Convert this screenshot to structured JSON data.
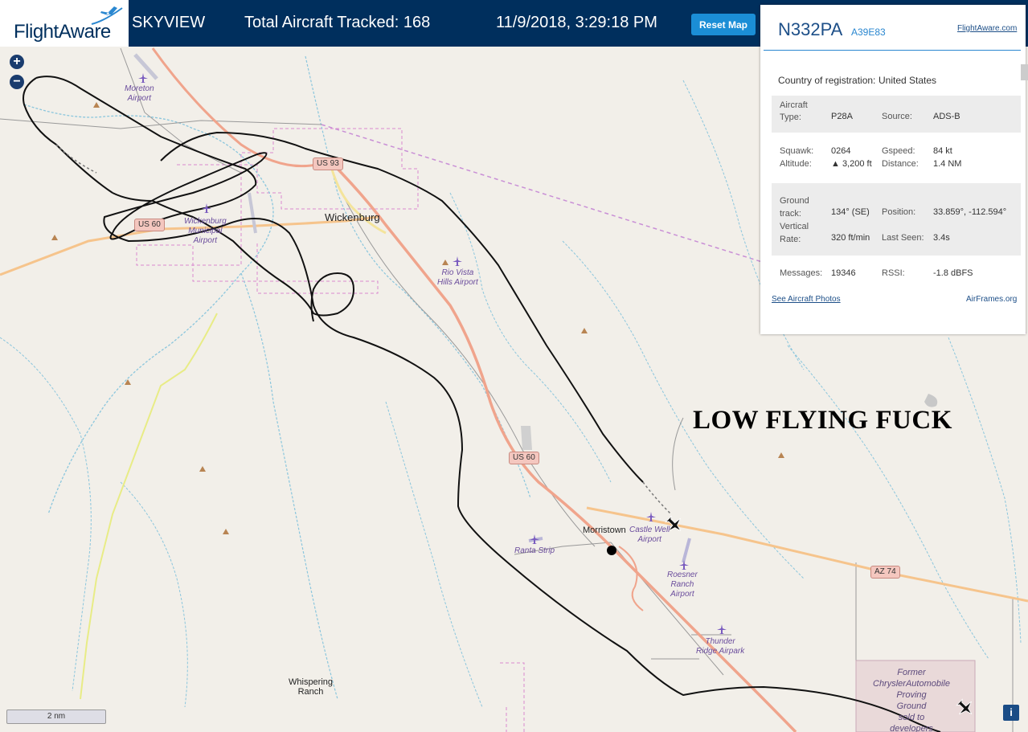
{
  "header": {
    "logo": "FlightAware",
    "app_name": "SKYVIEW",
    "tracked_label": "Total Aircraft Tracked: 168",
    "datetime": "11/9/2018, 3:29:18 PM",
    "reset_label": "Reset Map",
    "bg_color": "#002f5d"
  },
  "map": {
    "zoom_in": "+",
    "zoom_out": "−",
    "scale_label": "2 nm",
    "info_label": "i",
    "annotation": "LOW FLYING FUCK",
    "towns": {
      "wickenburg": "Wickenburg",
      "morristown": "Morristown",
      "whispering": "Whispering\nRanch"
    },
    "airports": {
      "moreton": "Moreton\nAirport",
      "wickenburg_muni": "Wickenburg\nMunicipal\nAirport",
      "rio_vista": "Rio Vista\nHills Airport",
      "castle_well": "Castle Well\nAirport",
      "ranta": "Ranta Strip",
      "roesner": "Roesner\nRanch\nAirport",
      "thunder": "Thunder\nRidge Airpark",
      "chrysler": "Former\nChryslerAutomobile\nProving\nGround\nsold to\ndevelopers"
    },
    "roads": {
      "us93": "US 93",
      "us60a": "US 60",
      "us60b": "US 60",
      "az74": "AZ 74"
    }
  },
  "panel": {
    "registration": "N332PA",
    "hex": "A39E83",
    "fa_link": "FlightAware.com",
    "country_label": "Country of registration:",
    "country": "United States",
    "aircraft_type_label": "Aircraft\nType:",
    "aircraft_type": "P28A",
    "source_label": "Source:",
    "source": "ADS-B",
    "squawk_label": "Squawk:",
    "squawk": "0264",
    "gspeed_label": "Gspeed:",
    "gspeed": "84 kt",
    "altitude_label": "Altitude:",
    "altitude": "▲ 3,200 ft",
    "distance_label": "Distance:",
    "distance": "1.4 NM",
    "track_label": "Ground\ntrack:",
    "track": "134° (SE)",
    "position_label": "Position:",
    "position": "33.859°, -112.594°",
    "vrate_label": "Vertical\nRate:",
    "vrate": "320 ft/min",
    "lastseen_label": "Last Seen:",
    "lastseen": "3.4s",
    "messages_label": "Messages:",
    "messages": "19346",
    "rssi_label": "RSSI:",
    "rssi": "-1.8 dBFS",
    "photos_link": "See Aircraft Photos",
    "airframes_link": "AirFrames.org"
  }
}
